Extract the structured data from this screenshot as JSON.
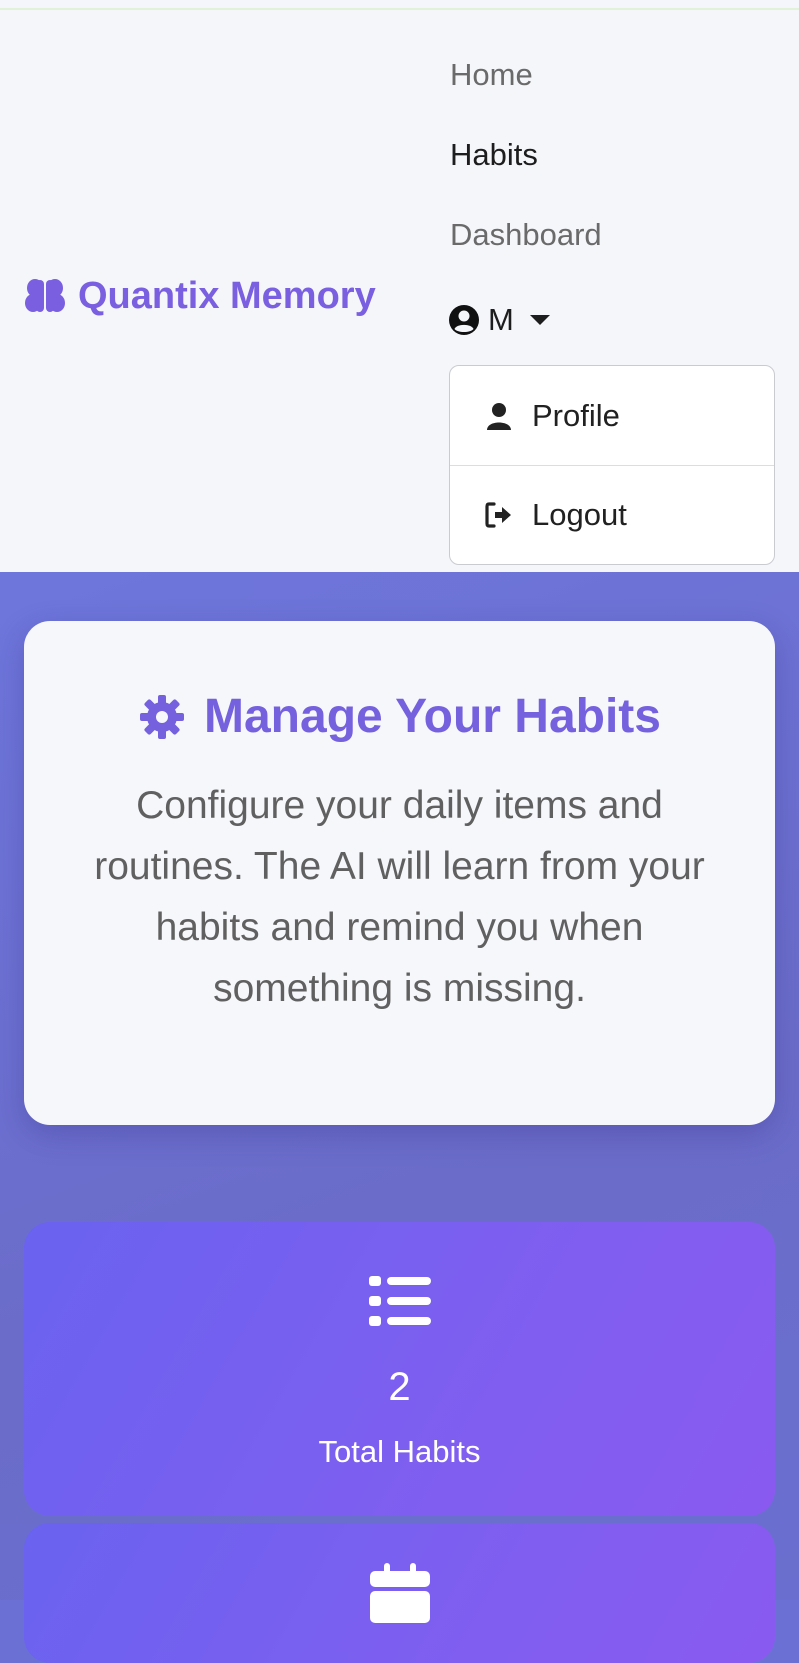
{
  "brand": {
    "name": "Quantix Memory",
    "icon": "brain-icon",
    "color": "#7a5fe0"
  },
  "nav": {
    "links": [
      {
        "label": "Home",
        "active": false
      },
      {
        "label": "Habits",
        "active": true
      },
      {
        "label": "Dashboard",
        "active": false
      }
    ],
    "user": {
      "initial": "M",
      "icon": "user-circle-icon"
    },
    "dropdown": {
      "items": [
        {
          "label": "Profile",
          "icon": "user-icon"
        },
        {
          "label": "Logout",
          "icon": "logout-icon"
        }
      ]
    }
  },
  "info_card": {
    "title": "Manage Your Habits",
    "icon": "gear-icon",
    "text": "Configure your daily items and routines. The AI will learn from your habits and remind you when something is missing."
  },
  "stats": [
    {
      "value": "2",
      "label": "Total Habits",
      "icon": "list-icon"
    },
    {
      "icon": "calendar-icon"
    }
  ]
}
